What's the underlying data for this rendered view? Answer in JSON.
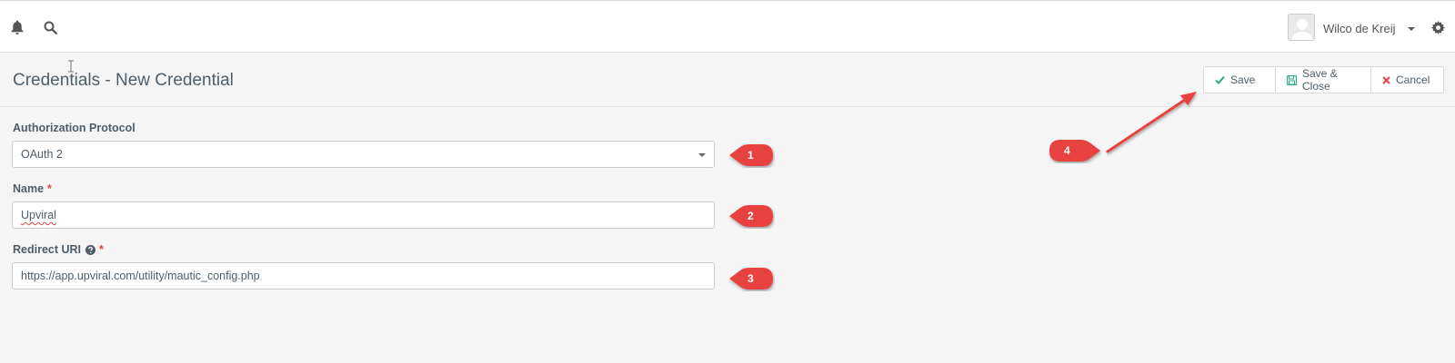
{
  "topbar": {
    "icons": [
      "bell-icon",
      "search-icon",
      "gear-icon"
    ],
    "user_name": "Wilco de Kreij"
  },
  "header": {
    "title": "Credentials - New Credential",
    "buttons": {
      "save": "Save",
      "save_close": "Save & Close",
      "cancel": "Cancel"
    }
  },
  "form": {
    "protocol_label": "Authorization Protocol",
    "protocol_value": "OAuth 2",
    "name_label": "Name",
    "name_value": "Upviral",
    "redirect_label": "Redirect URI",
    "redirect_value": "https://app.upviral.com/utility/mautic_config.php",
    "required_mark": "*"
  },
  "annotations": [
    "1",
    "2",
    "3",
    "4"
  ],
  "colors": {
    "callout_red": "#e8423f",
    "save_check": "#2ba982",
    "cancel_x": "#e5453d"
  }
}
